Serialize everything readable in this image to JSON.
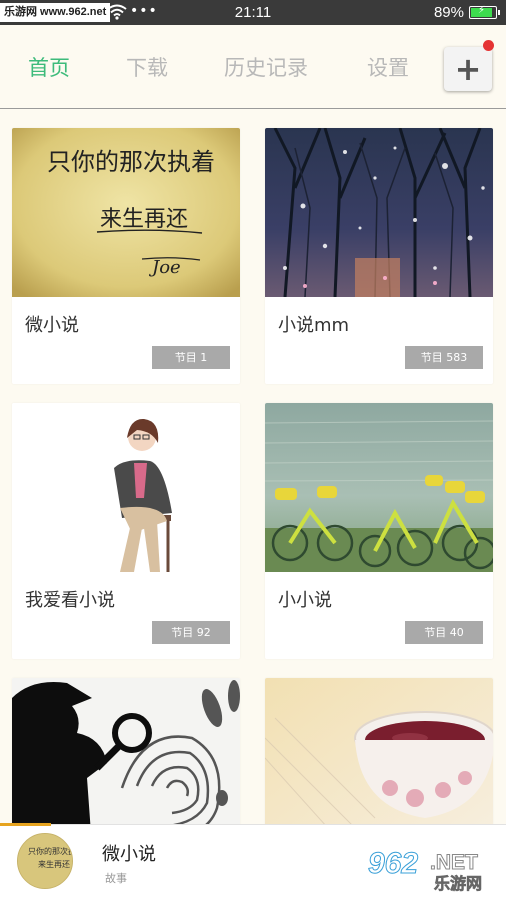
{
  "status_bar": {
    "watermark": "乐游网 www.962.net",
    "dots": "•••",
    "time": "21:11",
    "battery_percent": "89%",
    "battery_level": 0.89
  },
  "tabs": [
    {
      "label": "首页",
      "active": true
    },
    {
      "label": "下载",
      "active": false
    },
    {
      "label": "历史记录",
      "active": false
    },
    {
      "label": "设置",
      "active": false
    }
  ],
  "add_button": {
    "label": "+",
    "has_notification_dot": true
  },
  "cards": [
    {
      "title": "微小说",
      "badge": "节目 1",
      "cover_text_1": "只你的那次执着",
      "cover_text_2": "来生再还",
      "cover_text_3": "Joe"
    },
    {
      "title": "小说mm",
      "badge": "节目 583"
    },
    {
      "title": "我爱看小说",
      "badge": "节目 92"
    },
    {
      "title": "小小说",
      "badge": "节目 40"
    },
    {
      "title": "",
      "badge": ""
    },
    {
      "title": "",
      "badge": ""
    }
  ],
  "player": {
    "title": "微小说",
    "subtitle": "故事",
    "progress": 0.1
  },
  "watermark_logo": {
    "number": "962",
    "domain": ".NET",
    "brand": "乐游网"
  },
  "colors": {
    "accent": "#3dbb7b",
    "tab_inactive": "#b8b8b8",
    "badge_bg": "#a9a9a9",
    "notification": "#e53333",
    "progress": "#e6a31e"
  }
}
